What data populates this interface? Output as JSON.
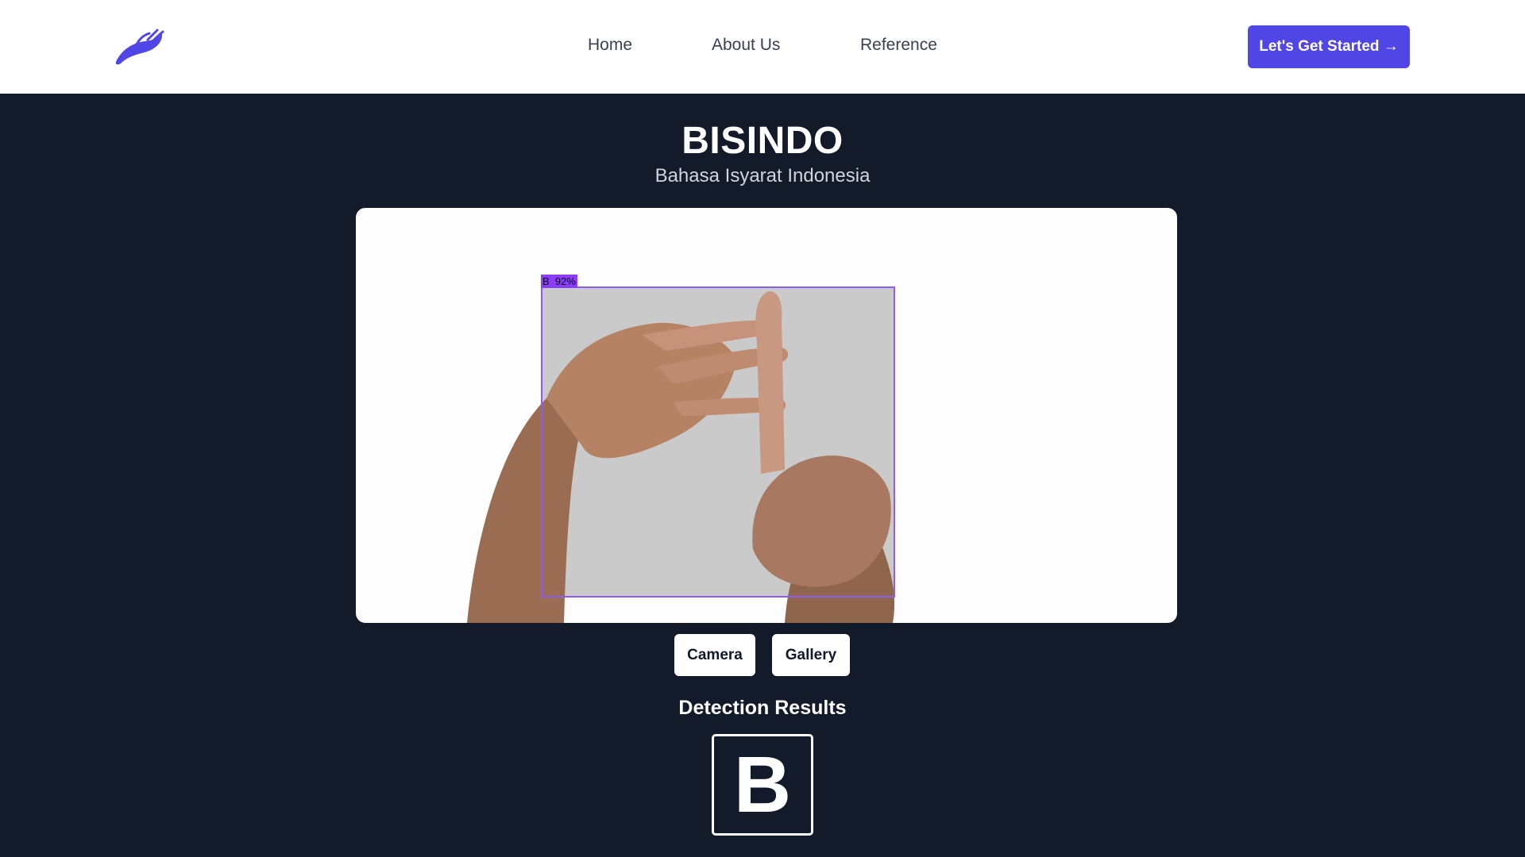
{
  "header": {
    "logo_icon": "hand-wave-logo-icon",
    "nav": {
      "home": "Home",
      "about": "About Us",
      "reference": "Reference"
    },
    "cta_label": "Let's Get Started →",
    "accent_color": "#4f46e5"
  },
  "hero": {
    "title": "BISINDO",
    "subtitle": "Bahasa Isyarat Indonesia"
  },
  "detection": {
    "box_label": "B  92%",
    "box_color": "#8b5cf6"
  },
  "controls": {
    "camera_label": "Camera",
    "gallery_label": "Gallery"
  },
  "results": {
    "title": "Detection Results",
    "letter": "B"
  }
}
